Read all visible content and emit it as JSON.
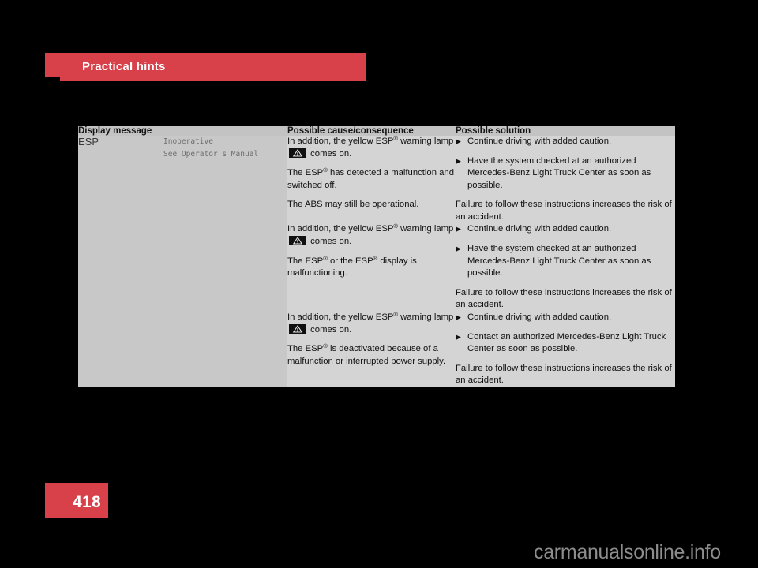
{
  "page": {
    "chapter_title": "Practical hints",
    "page_number": "418",
    "watermark": "carmanualsonline.info",
    "accent_color": "#d8404a"
  },
  "table": {
    "headers": [
      "Display message",
      "Possible cause/consequence",
      "Possible solution"
    ],
    "message": {
      "name": "ESP",
      "display_lines": "Inoperative\nSee Operator's Manual"
    },
    "rows": [
      {
        "cause": {
          "lead_before": "In addition, the yellow ESP",
          "lead_reg": "®",
          "lead_after": " warning lamp",
          "lamp_icon": "warning-triangle-lamp-icon",
          "lead_tail": "comes on.",
          "paragraphs": [
            {
              "before": "The ESP",
              "reg": "®",
              "after": " has detected a malfunction and switched off."
            },
            {
              "before": "The ABS may still be operational.",
              "reg": "",
              "after": ""
            }
          ]
        },
        "solution": {
          "bullets": [
            "Continue driving with added caution.",
            "Have the system checked at an authorized Mercedes-Benz Light Truck Center as soon as possible."
          ],
          "note": "Failure to follow these instructions increases the risk of an accident."
        }
      },
      {
        "cause": {
          "lead_before": "In addition, the yellow ESP",
          "lead_reg": "®",
          "lead_after": " warning lamp",
          "lamp_icon": "warning-triangle-lamp-icon",
          "lead_tail": "comes on.",
          "paragraphs": [
            {
              "before": "The ESP",
              "reg": "®",
              "after": " or the ESP",
              "reg2": "®",
              "after2": " display is malfunctioning."
            }
          ]
        },
        "solution": {
          "bullets": [
            "Continue driving with added caution.",
            "Have the system checked at an authorized Mercedes-Benz Light Truck Center as soon as possible."
          ],
          "note": "Failure to follow these instructions increases the risk of an accident."
        }
      },
      {
        "cause": {
          "lead_before": "In addition, the yellow ESP",
          "lead_reg": "®",
          "lead_after": " warning lamp",
          "lamp_icon": "warning-triangle-lamp-icon",
          "lead_tail": "comes on.",
          "paragraphs": [
            {
              "before": "The ESP",
              "reg": "®",
              "after": " is deactivated because of a malfunction or interrupted power supply."
            }
          ]
        },
        "solution": {
          "bullets": [
            "Continue driving with added caution.",
            "Contact an authorized Mercedes-Benz Light Truck Center as soon as possible."
          ],
          "note": "Failure to follow these instructions increases the risk of an accident."
        }
      }
    ],
    "bullet_glyph": "▶"
  }
}
